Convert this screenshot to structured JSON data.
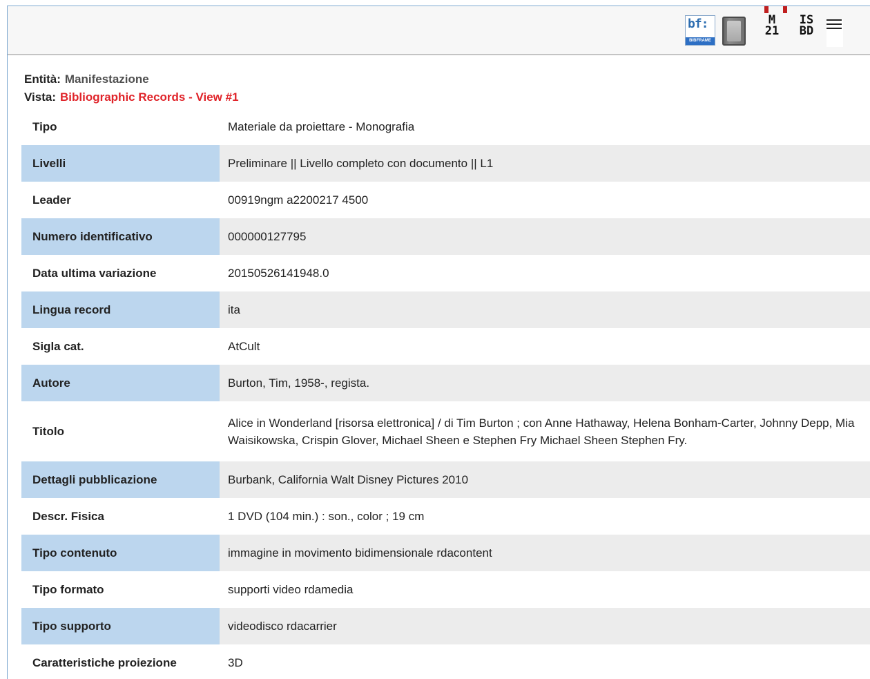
{
  "toolbar": {
    "icons": [
      "bibframe-icon",
      "book-icon",
      "marc21-icon",
      "isbd-icon",
      "list-icon"
    ],
    "bf_text": "bf:",
    "bf_band": "BIBFRAME",
    "marc_line1": "M",
    "marc_line2": "21",
    "isbd_line1": "IS",
    "isbd_line2": "BD",
    "accent_red": "#c01f1f"
  },
  "entity": {
    "label": "Entità:",
    "value": "Manifestazione"
  },
  "vista": {
    "label": "Vista:",
    "value": "Bibliographic Records - View #1",
    "color": "#e0242a"
  },
  "colors": {
    "label_alt_bg": "#bcd6ee",
    "value_alt_bg": "#ececec",
    "frame_border": "#7aa6cf"
  },
  "record": [
    {
      "label": "Tipo",
      "value": "Materiale da proiettare - Monografia"
    },
    {
      "label": "Livelli",
      "value": "Preliminare || Livello completo con documento || L1"
    },
    {
      "label": "Leader",
      "value": "00919ngm a2200217 4500"
    },
    {
      "label": "Numero identificativo",
      "value": "000000127795"
    },
    {
      "label": "Data ultima variazione",
      "value": "20150526141948.0"
    },
    {
      "label": "Lingua record",
      "value": "ita"
    },
    {
      "label": "Sigla cat.",
      "value": "AtCult"
    },
    {
      "label": "Autore",
      "value": "Burton, Tim, 1958-, regista."
    },
    {
      "label": "Titolo",
      "value": "Alice in Wonderland [risorsa elettronica] / di Tim Burton ; con Anne Hathaway, Helena Bonham-Carter, Johnny Depp, Mia Waisikowska, Crispin Glover, Michael Sheen e Stephen Fry Michael Sheen Stephen Fry."
    },
    {
      "label": "Dettagli pubblicazione",
      "value": "Burbank, California Walt Disney Pictures 2010"
    },
    {
      "label": "Descr. Fisica",
      "value": "1 DVD (104 min.) : son., color ; 19 cm"
    },
    {
      "label": "Tipo contenuto",
      "value": "immagine in movimento bidimensionale rdacontent"
    },
    {
      "label": "Tipo formato",
      "value": "supporti video rdamedia"
    },
    {
      "label": "Tipo supporto",
      "value": "videodisco rdacarrier"
    },
    {
      "label": "Caratteristiche proiezione",
      "value": "3D"
    }
  ]
}
